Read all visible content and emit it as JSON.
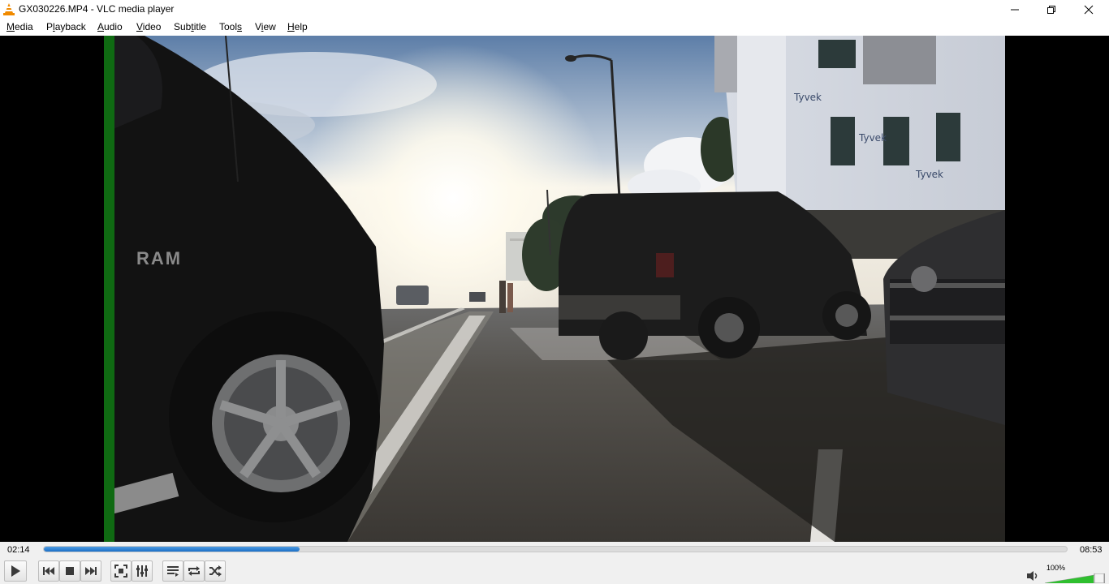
{
  "window": {
    "title": "GX030226.MP4 - VLC media player",
    "app_icon": "vlc-cone-icon",
    "controls": [
      "minimize-icon",
      "maximize-icon",
      "close-icon"
    ]
  },
  "menu": {
    "items": [
      {
        "label": "Media",
        "accel": "M"
      },
      {
        "label": "Playback",
        "accel": "l"
      },
      {
        "label": "Audio",
        "accel": "A"
      },
      {
        "label": "Video",
        "accel": "V"
      },
      {
        "label": "Subtitle",
        "accel": "t"
      },
      {
        "label": "Tools",
        "accel": "s"
      },
      {
        "label": "View",
        "accel": "i"
      },
      {
        "label": "Help",
        "accel": "H"
      }
    ]
  },
  "player": {
    "elapsed": "02:14",
    "duration": "08:53",
    "progress_fraction": 0.25,
    "volume_label": "100%",
    "volume_fraction": 1.0
  },
  "video": {
    "badge_text": "RAM",
    "wrap_text": "Tyvek"
  },
  "colors": {
    "seek_fill": "#1b6fc7",
    "volume_fill": "#2fbf2f",
    "left_edge_green": "#0f6a12",
    "vlc_orange": "#f08a00"
  },
  "toolbar_icons": [
    "play-icon",
    "previous-icon",
    "stop-icon",
    "next-icon",
    "fullscreen-icon",
    "extended-settings-icon",
    "playlist-icon",
    "loop-icon",
    "shuffle-icon",
    "speaker-icon"
  ]
}
